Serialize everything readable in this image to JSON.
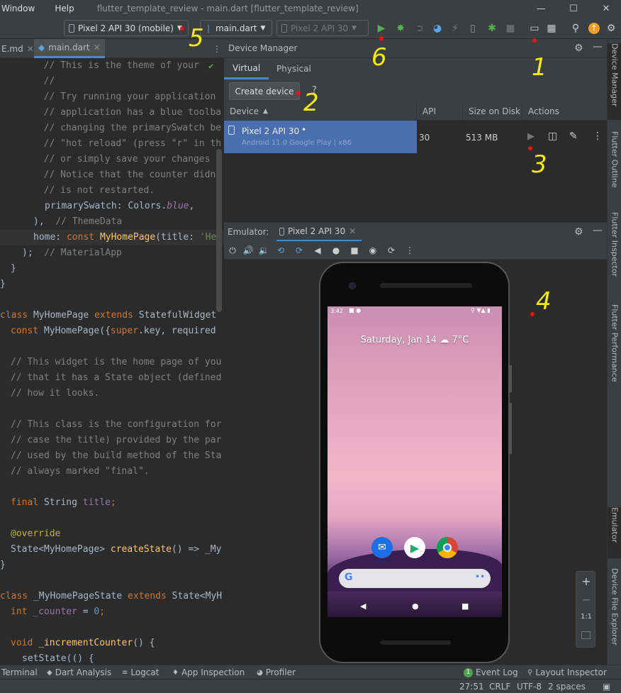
{
  "titlebar": {
    "menu_window": "Window",
    "menu_help": "Help",
    "title": "flutter_template_review - main.dart [flutter_template_review]"
  },
  "toolbar": {
    "device_combo": "Pixel 2 API 30 (mobile)",
    "config_combo": "main.dart",
    "avd_combo": "Pixel 2 API 30"
  },
  "editor": {
    "tab_md": "E.md",
    "tab_main": "main.dart",
    "lines": [
      {
        "n": 0,
        "t": "  // This is the theme of your "
      },
      {
        "n": 1,
        "t": "  //"
      },
      {
        "n": 2,
        "t": "  // Try running your application"
      },
      {
        "n": 3,
        "t": "  // application has a blue toolba"
      },
      {
        "n": 4,
        "t": "  // changing the primarySwatch be"
      },
      {
        "n": 5,
        "t": "  // \"hot reload\" (press \"r\" in th"
      },
      {
        "n": 6,
        "t": "  // or simply save your changes t"
      },
      {
        "n": 7,
        "t": "  // Notice that the counter didn"
      },
      {
        "n": 8,
        "t": "  // is not restarted."
      }
    ],
    "primary_swatch_key": "primarySwatch: ",
    "primary_swatch_cls": "Colors.",
    "primary_swatch_val": "blue",
    "theme_close": "),",
    "theme_comment": "// ThemeData",
    "home_key": "home: ",
    "home_kw": "const ",
    "home_cls": "MyHomePage",
    "home_args": "(title: ",
    "home_str": "'He",
    "app_close": ");",
    "app_comment": "// MaterialApp",
    "brace1": "}",
    "brace2": "}",
    "class1_kw": "class ",
    "class1_name": "MyHomePage ",
    "class1_ext": "extends ",
    "class1_sup": "StatefulWidget",
    "ctor_kw": "const ",
    "ctor_name": "MyHomePage",
    "ctor_args1": "({",
    "ctor_super": "super",
    "ctor_args2": ".key, required",
    "c2": [
      "// This widget is the home page of you",
      "// that it has a State object (defined",
      "// how it looks.",
      "// This class is the configuration for",
      "// case the title) provided by the par",
      "// used by the build method of the Sta",
      "// always marked \"final\"."
    ],
    "final_kw": "final ",
    "final_type": "String ",
    "final_name": "title",
    "final_end": ";",
    "override": "@override",
    "cs_type": "State<MyHomePage> ",
    "cs_fn": "createState",
    "cs_rest": "() => _My",
    "brace3": "}",
    "class2_kw": "class ",
    "class2_name": "_MyHomePageState ",
    "class2_ext": "extends ",
    "class2_sup": "State<MyH",
    "int_kw": "int ",
    "int_name": "_counter",
    "int_eq": " = ",
    "int_val": "0",
    "int_end": ";",
    "void_kw": "void ",
    "void_fn": "_incrementCounter",
    "void_rest": "() {",
    "setstate": "setState(() {"
  },
  "device_manager": {
    "title": "Device Manager",
    "tab_virtual": "Virtual",
    "tab_physical": "Physical",
    "create_device": "Create device",
    "help": "?",
    "col_device": "Device",
    "col_api": "API",
    "col_size": "Size on Disk",
    "col_actions": "Actions",
    "row": {
      "name": "Pixel 2 API 30",
      "sub": "Android 11.0 Google Play | x86",
      "api": "30",
      "size": "513 MB"
    }
  },
  "emulator": {
    "label": "Emulator:",
    "tab": "Pixel 2 API 30",
    "status_time": "3:42",
    "date": "Saturday, Jan 14",
    "weather": "7°C"
  },
  "zoom": {
    "plus": "+",
    "minus": "−",
    "one": "1:1"
  },
  "right_sidebar": {
    "device_manager": "Device Manager",
    "flutter_outline": "Flutter Outline",
    "flutter_inspector": "Flutter Inspector",
    "flutter_performance": "Flutter Performance",
    "emulator": "Emulator",
    "file_explorer": "Device File Explorer"
  },
  "bottom": {
    "terminal": "Terminal",
    "dart_analysis": "Dart Analysis",
    "logcat": "Logcat",
    "app_inspection": "App Inspection",
    "profiler": "Profiler",
    "event_log": "Event Log",
    "layout_inspector": "Layout Inspector",
    "event_count": "1"
  },
  "status": {
    "position": "27:51",
    "line_sep": "CRLF",
    "encoding": "UTF-8",
    "indent": "2 spaces"
  },
  "annotations": {
    "a1": "1",
    "a2": "2",
    "a3": "3",
    "a4": "4",
    "a5": "5",
    "a6": "6"
  },
  "colors": {
    "accent": "#4a88c7",
    "selection": "#4b6eaf",
    "annotation": "#f5ec00"
  }
}
